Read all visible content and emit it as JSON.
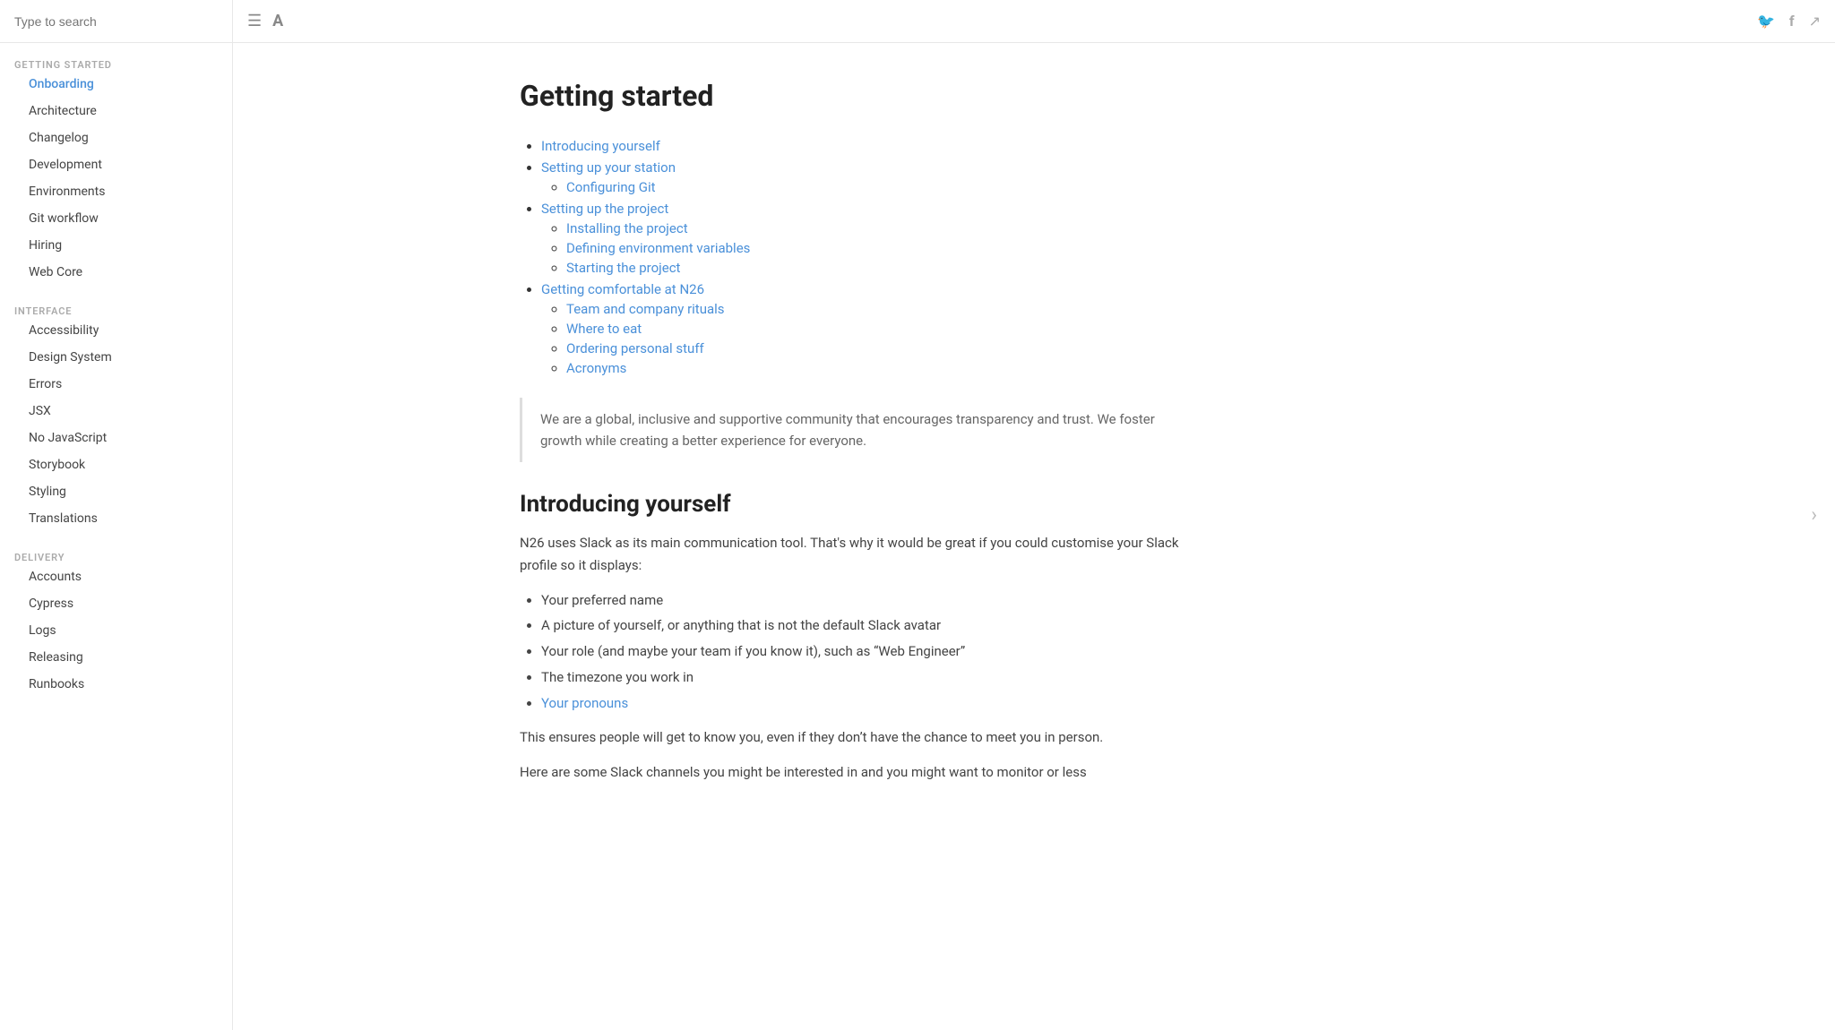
{
  "search": {
    "placeholder": "Type to search"
  },
  "sidebar": {
    "sections": [
      {
        "label": "GETTING STARTED",
        "items": [
          {
            "id": "onboarding",
            "label": "Onboarding",
            "active": true
          },
          {
            "id": "architecture",
            "label": "Architecture",
            "active": false
          },
          {
            "id": "changelog",
            "label": "Changelog",
            "active": false
          },
          {
            "id": "development",
            "label": "Development",
            "active": false
          },
          {
            "id": "environments",
            "label": "Environments",
            "active": false
          },
          {
            "id": "git-workflow",
            "label": "Git workflow",
            "active": false
          },
          {
            "id": "hiring",
            "label": "Hiring",
            "active": false
          },
          {
            "id": "web-core",
            "label": "Web Core",
            "active": false
          }
        ]
      },
      {
        "label": "INTERFACE",
        "items": [
          {
            "id": "accessibility",
            "label": "Accessibility",
            "active": false
          },
          {
            "id": "design-system",
            "label": "Design System",
            "active": false
          },
          {
            "id": "errors",
            "label": "Errors",
            "active": false
          },
          {
            "id": "jsx",
            "label": "JSX",
            "active": false
          },
          {
            "id": "no-javascript",
            "label": "No JavaScript",
            "active": false
          },
          {
            "id": "storybook",
            "label": "Storybook",
            "active": false
          },
          {
            "id": "styling",
            "label": "Styling",
            "active": false
          },
          {
            "id": "translations",
            "label": "Translations",
            "active": false
          }
        ]
      },
      {
        "label": "DELIVERY",
        "items": [
          {
            "id": "accounts",
            "label": "Accounts",
            "active": false
          },
          {
            "id": "cypress",
            "label": "Cypress",
            "active": false
          },
          {
            "id": "logs",
            "label": "Logs",
            "active": false
          },
          {
            "id": "releasing",
            "label": "Releasing",
            "active": false
          },
          {
            "id": "runbooks",
            "label": "Runbooks",
            "active": false
          }
        ]
      }
    ]
  },
  "page": {
    "title": "Getting started",
    "toc": [
      {
        "label": "Introducing yourself",
        "href": "#introducing-yourself",
        "children": []
      },
      {
        "label": "Setting up your station",
        "href": "#setting-up-your-station",
        "children": [
          {
            "label": "Configuring Git",
            "href": "#configuring-git"
          }
        ]
      },
      {
        "label": "Setting up the project",
        "href": "#setting-up-the-project",
        "children": [
          {
            "label": "Installing the project",
            "href": "#installing-the-project"
          },
          {
            "label": "Defining environment variables",
            "href": "#defining-environment-variables"
          },
          {
            "label": "Starting the project",
            "href": "#starting-the-project"
          }
        ]
      },
      {
        "label": "Getting comfortable at N26",
        "href": "#getting-comfortable-at-n26",
        "children": [
          {
            "label": "Team and company rituals",
            "href": "#team-and-company-rituals"
          },
          {
            "label": "Where to eat",
            "href": "#where-to-eat"
          },
          {
            "label": "Ordering personal stuff",
            "href": "#ordering-personal-stuff"
          },
          {
            "label": "Acronyms",
            "href": "#acronyms"
          }
        ]
      }
    ],
    "blockquote": "We are a global, inclusive and supportive community that encourages transparency and trust. We foster growth while creating a better experience for everyone.",
    "section2_title": "Introducing yourself",
    "section2_body1": "N26 uses Slack as its main communication tool. That's why it would be great if you could customise your Slack profile so it displays:",
    "section2_bullets": [
      {
        "text": "Your preferred name",
        "link": false
      },
      {
        "text": "A picture of yourself, or anything that is not the default Slack avatar",
        "link": false
      },
      {
        "text": "Your role (and maybe your team if you know it), such as “Web Engineer”",
        "link": false
      },
      {
        "text": "The timezone you work in",
        "link": false
      },
      {
        "text": "Your pronouns",
        "link": true,
        "href": "#your-pronouns"
      }
    ],
    "section2_body2": "This ensures people will get to know you, even if they don’t have the chance to meet you in person.",
    "section2_body3": "Here are some Slack channels you might be interested in and you might want to monitor or less"
  },
  "topbar": {
    "menu_icon": "☰",
    "font_icon": "A",
    "twitter_icon": "🐦",
    "facebook_icon": "f",
    "share_icon": "↗"
  }
}
